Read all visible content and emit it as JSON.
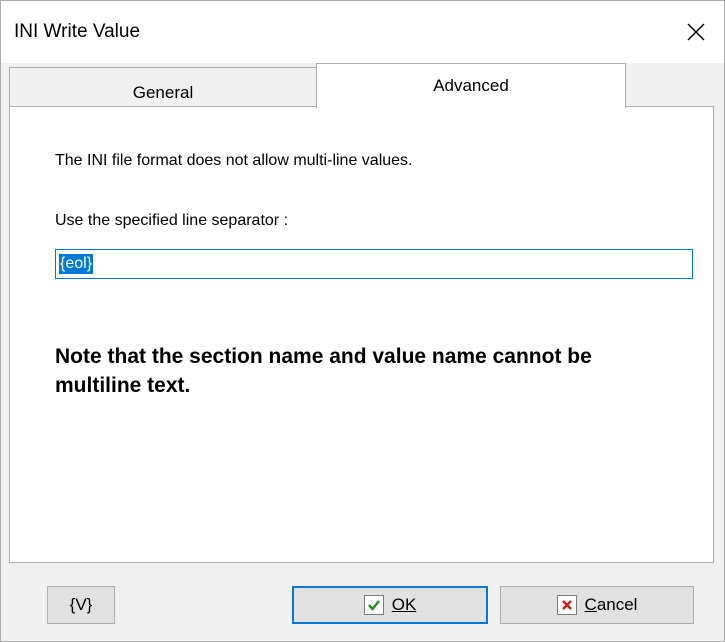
{
  "window": {
    "title": "INI Write Value"
  },
  "tabs": [
    {
      "label": "General",
      "active": false
    },
    {
      "label": "Advanced",
      "active": true
    }
  ],
  "advanced": {
    "description": "The INI file format does not allow multi-line values.",
    "separator_label": "Use the specified line separator :",
    "separator_value": "{eol}",
    "note": "Note that the section name and value name cannot be multiline text."
  },
  "buttons": {
    "variables_label": "{V}",
    "ok_label": "OK",
    "cancel_label": "Cancel"
  },
  "icons": {
    "close": "close-icon",
    "ok": "check-icon",
    "cancel": "x-icon"
  },
  "colors": {
    "accent": "#0078d7",
    "ok_check": "#1e8a1e",
    "cancel_x": "#d11a1a"
  }
}
